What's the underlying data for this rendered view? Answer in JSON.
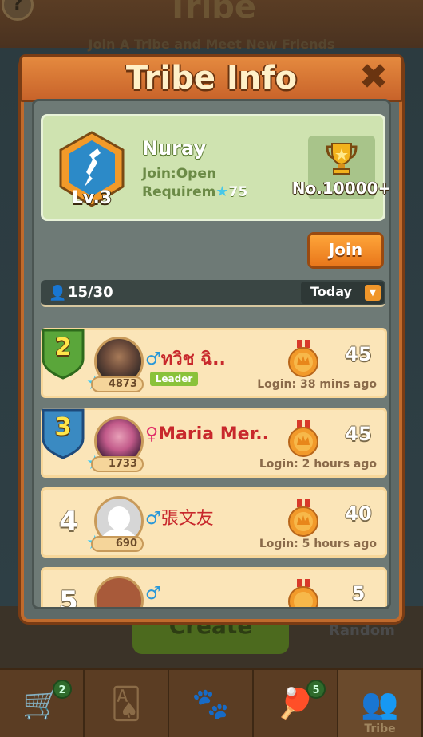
{
  "background": {
    "title": "Tribe",
    "subtitle": "Join A Tribe and Meet New Friends",
    "help_label": "?",
    "create_label": "Create",
    "random_label": "Random"
  },
  "bottom_nav": [
    {
      "icon": "shop-cart-icon",
      "glyph": "🛒",
      "badge": "2",
      "label": ""
    },
    {
      "icon": "cards-icon",
      "glyph": "🂡",
      "badge": "",
      "label": ""
    },
    {
      "icon": "paw-icon",
      "glyph": "🐾",
      "badge": "",
      "label": ""
    },
    {
      "icon": "pingpong-icon",
      "glyph": "🏓",
      "badge": "5",
      "label": ""
    },
    {
      "icon": "tribe-icon",
      "glyph": "👥",
      "badge": "",
      "label": "Tribe"
    }
  ],
  "modal": {
    "title": "Tribe Info",
    "close_glyph": "✖"
  },
  "tribe": {
    "level": "Lv.3",
    "name": "Nuray",
    "join_type": "Join:Open",
    "requirement_label": "Requirem",
    "requirement_star": "★",
    "requirement_value": "75",
    "rank": "No.10000+"
  },
  "join_button": "Join",
  "members_bar": {
    "icon": "👤",
    "count": "15/30",
    "period": "Today",
    "period_arrow": "▼"
  },
  "members": [
    {
      "rank": "2",
      "gender": "♂",
      "name": "ทวิช ฉิ..",
      "score": "4873",
      "leader": "Leader",
      "activity": "45",
      "last_login": "Login: 38 mins ago"
    },
    {
      "rank": "3",
      "gender": "♀",
      "name": "Maria Mer..",
      "score": "1733",
      "leader": "",
      "activity": "45",
      "last_login": "Login: 2 hours ago"
    },
    {
      "rank": "4",
      "gender": "♂",
      "name": "張文友",
      "score": "690",
      "leader": "",
      "activity": "40",
      "last_login": "Login: 5 hours ago"
    },
    {
      "rank": "5",
      "gender": "♂",
      "name": "",
      "score": "",
      "leader": "",
      "activity": "5",
      "last_login": ""
    }
  ],
  "colors": {
    "header": "#e58a3f",
    "info_card": "#cfe3b0",
    "row": "#fbe5b8",
    "join_button": "#f5902a",
    "star": "#48c8e8",
    "green_shield": "#5aa63a",
    "blue_shield": "#3a8ac2"
  }
}
